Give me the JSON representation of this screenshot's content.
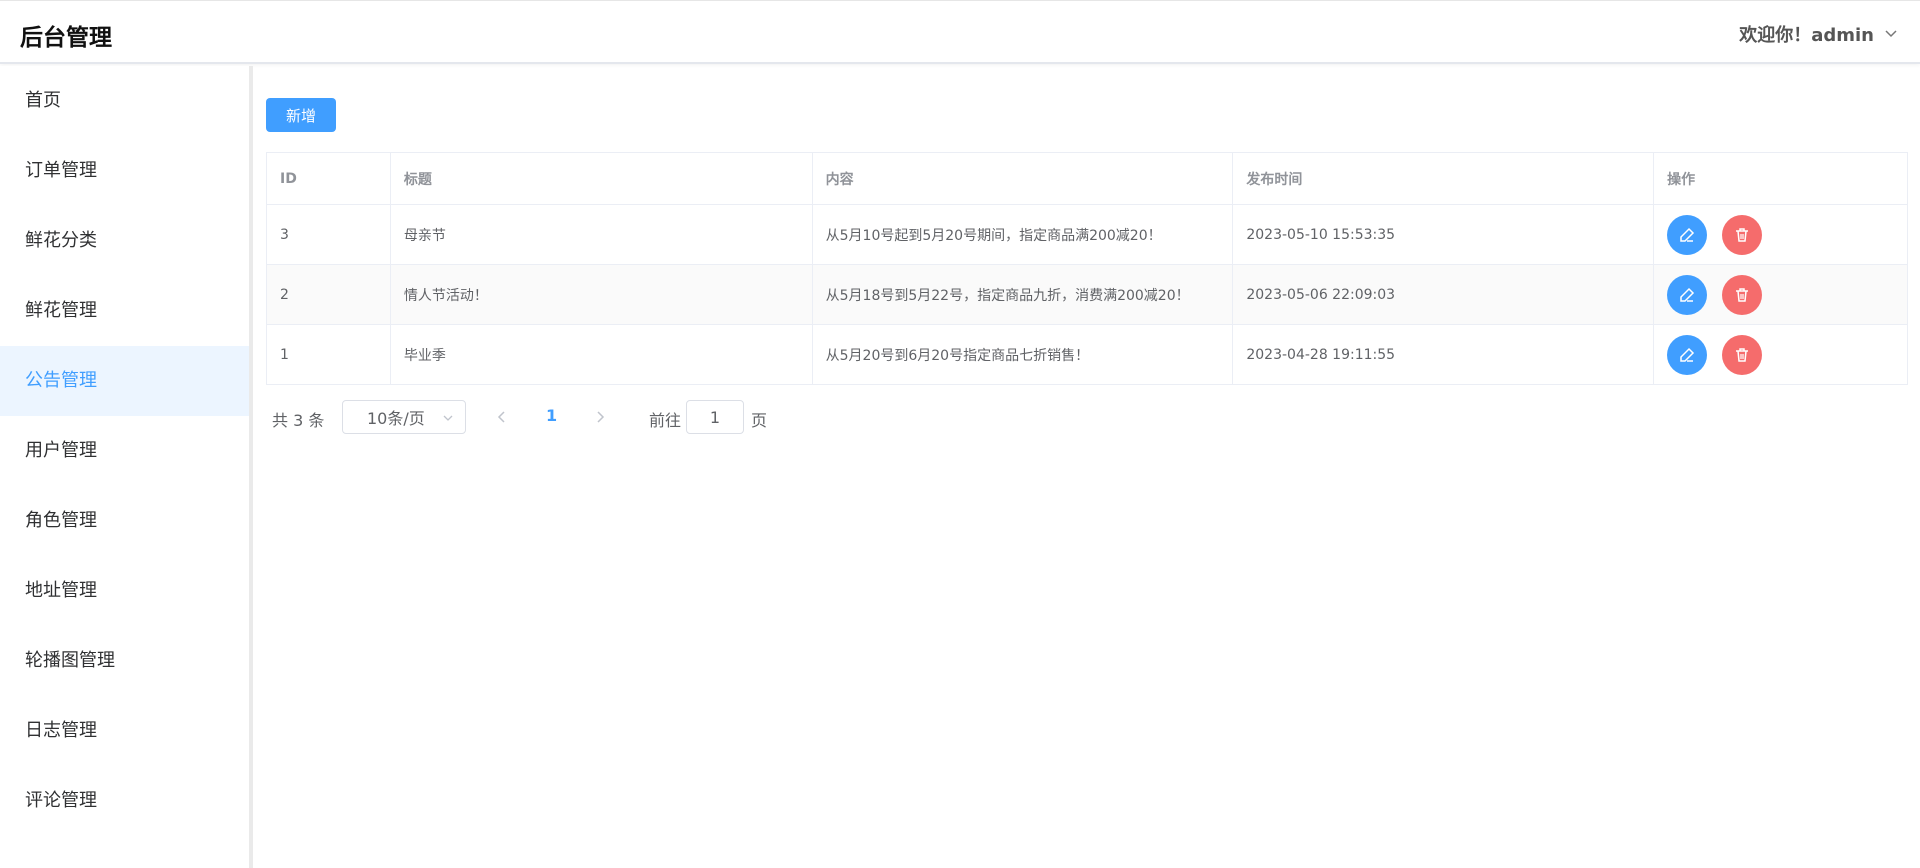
{
  "header": {
    "title": "后台管理",
    "greeting": "欢迎你！admin"
  },
  "sidebar": {
    "items": [
      {
        "label": "首页",
        "active": false
      },
      {
        "label": "订单管理",
        "active": false
      },
      {
        "label": "鲜花分类",
        "active": false
      },
      {
        "label": "鲜花管理",
        "active": false
      },
      {
        "label": "公告管理",
        "active": true
      },
      {
        "label": "用户管理",
        "active": false
      },
      {
        "label": "角色管理",
        "active": false
      },
      {
        "label": "地址管理",
        "active": false
      },
      {
        "label": "轮播图管理",
        "active": false
      },
      {
        "label": "日志管理",
        "active": false
      },
      {
        "label": "评论管理",
        "active": false
      }
    ]
  },
  "toolbar": {
    "add_label": "新增"
  },
  "table": {
    "columns": [
      "ID",
      "标题",
      "内容",
      "发布时间",
      "操作"
    ],
    "rows": [
      {
        "id": "3",
        "title": "母亲节",
        "content": "从5月10号起到5月20号期间，指定商品满200减20！",
        "time": "2023-05-10 15:53:35"
      },
      {
        "id": "2",
        "title": "情人节活动！",
        "content": "从5月18号到5月22号，指定商品九折，消费满200减20！",
        "time": "2023-05-06 22:09:03"
      },
      {
        "id": "1",
        "title": "毕业季",
        "content": "从5月20号到6月20号指定商品七折销售！",
        "time": "2023-04-28 19:11:55"
      }
    ]
  },
  "pagination": {
    "total_text": "共 3 条",
    "page_size": "10条/页",
    "current_page": "1",
    "goto_label": "前往",
    "goto_value": "1",
    "goto_suffix": "页"
  },
  "colors": {
    "primary": "#409eff",
    "danger": "#f56c6c",
    "active_bg": "#ecf5ff"
  },
  "icons": [
    "chevron-down-icon",
    "edit-icon",
    "delete-icon",
    "chevron-left-icon",
    "chevron-right-icon"
  ]
}
